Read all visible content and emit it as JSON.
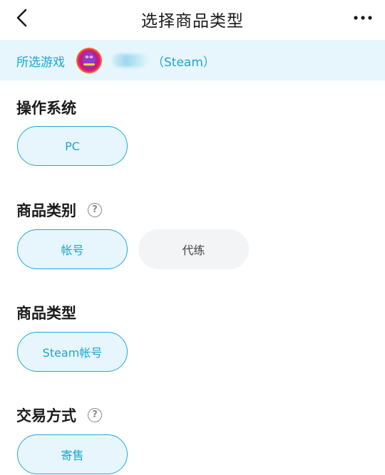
{
  "header": {
    "title": "选择商品类型"
  },
  "game": {
    "label": "所选游戏",
    "platform": "（Steam）"
  },
  "sections": [
    {
      "title": "操作系统",
      "has_help": false,
      "options": [
        {
          "label": "PC",
          "selected": true
        }
      ]
    },
    {
      "title": "商品类别",
      "has_help": true,
      "options": [
        {
          "label": "帐号",
          "selected": true
        },
        {
          "label": "代练",
          "selected": false
        }
      ]
    },
    {
      "title": "商品类型",
      "has_help": false,
      "options": [
        {
          "label": "Steam帐号",
          "selected": true
        }
      ]
    },
    {
      "title": "交易方式",
      "has_help": true,
      "options": [
        {
          "label": "寄售",
          "selected": true
        }
      ]
    }
  ],
  "help_glyph": "?",
  "colors": {
    "accent": "#1ea5cf",
    "selected_bg": "#e6f6fc",
    "unselected_bg": "#f3f4f6"
  }
}
